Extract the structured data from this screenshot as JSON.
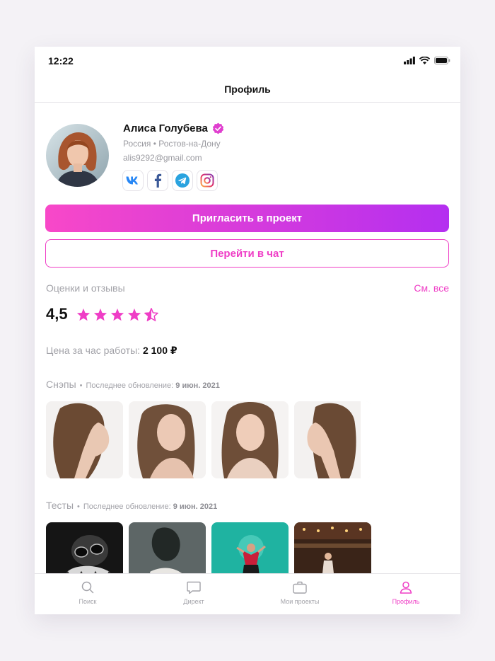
{
  "status_bar": {
    "time": "12:22"
  },
  "nav": {
    "title": "Профиль"
  },
  "profile": {
    "name": "Алиса Голубева",
    "country": "Россия",
    "separator": "•",
    "city": "Ростов-на-Дону",
    "email": "alis9292@gmail.com",
    "socials": [
      "vk-icon",
      "facebook-icon",
      "telegram-icon",
      "instagram-icon"
    ]
  },
  "actions": {
    "invite": "Пригласить в проект",
    "chat": "Перейти в чат"
  },
  "reviews": {
    "title": "Оценки и отзывы",
    "see_all": "См. все",
    "rating": "4,5",
    "stars": 4.5
  },
  "price": {
    "label": "Цена за час работы:",
    "value": "2 100 ₽"
  },
  "snaps": {
    "title": "Снэпы",
    "dot": "•",
    "updated_label": "Последнее обновление:",
    "updated_date": "9 июн. 2021"
  },
  "tests": {
    "title": "Тесты",
    "dot": "•",
    "updated_label": "Последнее обновление:",
    "updated_date": "9 июн. 2021"
  },
  "tabbar": {
    "search": "Поиск",
    "direct": "Директ",
    "projects": "Мои проекты",
    "profile": "Профиль"
  },
  "colors": {
    "accent": "#ef3ec6",
    "gradient_start": "#f848c8",
    "gradient_end": "#b42ff0"
  }
}
